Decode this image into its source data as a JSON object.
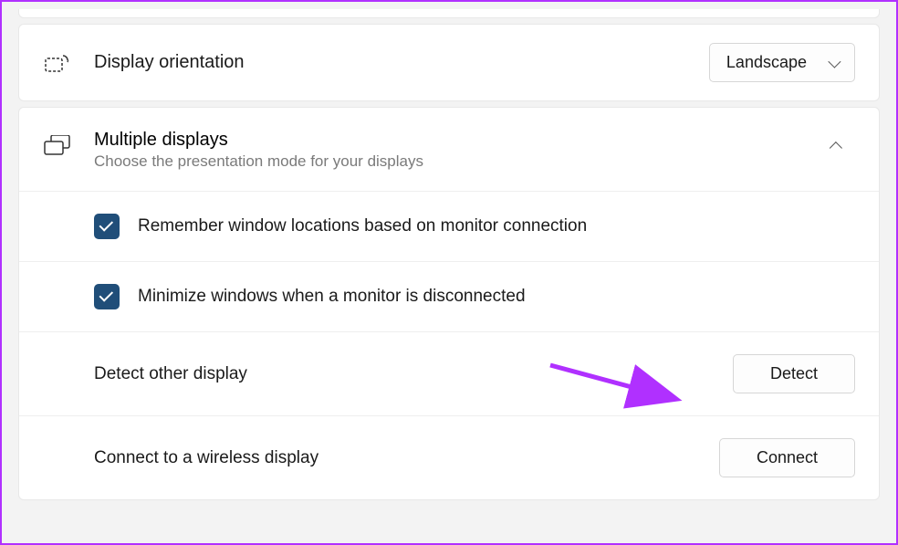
{
  "orientation": {
    "title": "Display orientation",
    "selected": "Landscape"
  },
  "multiple": {
    "title": "Multiple displays",
    "subtitle": "Choose the presentation mode for your displays",
    "options": {
      "remember": "Remember window locations based on monitor connection",
      "minimize": "Minimize windows when a monitor is disconnected"
    },
    "detect": {
      "label": "Detect other display",
      "button": "Detect"
    },
    "connect": {
      "label": "Connect to a wireless display",
      "button": "Connect"
    }
  }
}
